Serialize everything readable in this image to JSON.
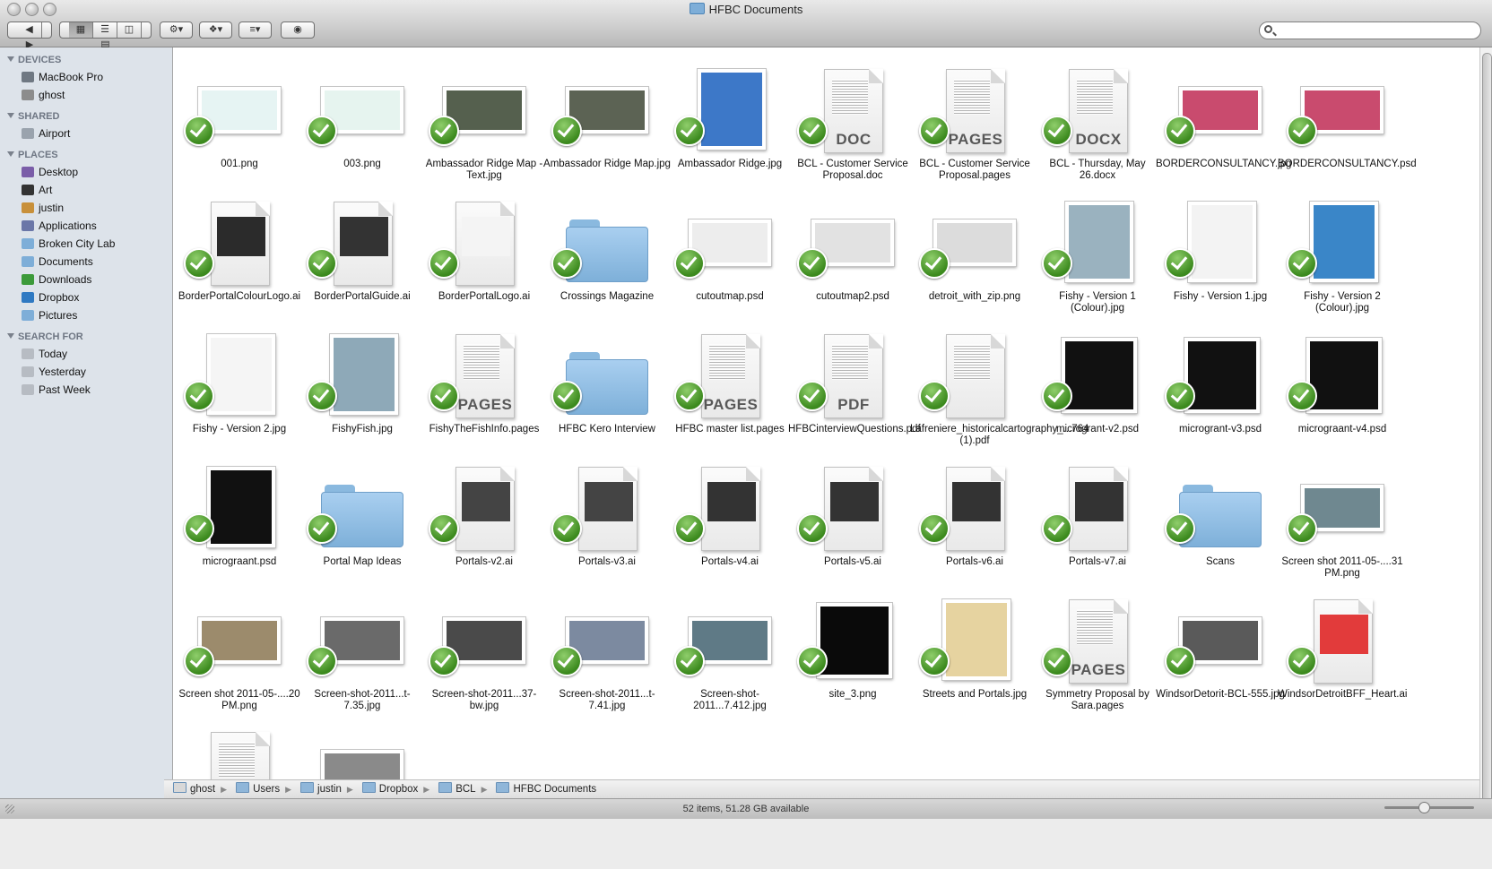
{
  "window": {
    "title": "HFBC Documents"
  },
  "sidebar": {
    "sections": [
      {
        "title": "DEVICES",
        "items": [
          "MacBook Pro",
          "ghost"
        ]
      },
      {
        "title": "SHARED",
        "items": [
          "Airport"
        ]
      },
      {
        "title": "PLACES",
        "items": [
          "Desktop",
          "Art",
          "justin",
          "Applications",
          "Broken City Lab",
          "Documents",
          "Downloads",
          "Dropbox",
          "Pictures"
        ]
      },
      {
        "title": "SEARCH FOR",
        "items": [
          "Today",
          "Yesterday",
          "Past Week"
        ]
      }
    ]
  },
  "files": [
    {
      "name": "001.png",
      "kind": "img",
      "c": "#e6f4f3"
    },
    {
      "name": "003.png",
      "kind": "img",
      "c": "#e6f4ef"
    },
    {
      "name": "Ambassador Ridge Map - Text.jpg",
      "kind": "img",
      "c": "#55604e"
    },
    {
      "name": "Ambassador Ridge Map.jpg",
      "kind": "img",
      "c": "#5c6354"
    },
    {
      "name": "Ambassador Ridge.jpg",
      "kind": "imgtall",
      "c": "#3d78c8"
    },
    {
      "name": "BCL - Customer Service Proposal.doc",
      "kind": "doc",
      "ext": "DOC"
    },
    {
      "name": "BCL - Customer Service Proposal.pages",
      "kind": "doc",
      "ext": "PAGES"
    },
    {
      "name": "BCL - Thursday, May 26.docx",
      "kind": "doc",
      "ext": "DOCX"
    },
    {
      "name": "BORDERCONSULTANCY.jpg",
      "kind": "img",
      "c": "#c94b6e"
    },
    {
      "name": "BORDERCONSULTANCY.psd",
      "kind": "img",
      "c": "#c94b6e"
    },
    {
      "name": "BorderPortalColourLogo.ai",
      "kind": "ai",
      "c": "#2b2b2b"
    },
    {
      "name": "BorderPortalGuide.ai",
      "kind": "ai",
      "c": "#333333"
    },
    {
      "name": "BorderPortalLogo.ai",
      "kind": "ai",
      "c": "#f4f4f4"
    },
    {
      "name": "Crossings Magazine",
      "kind": "folder"
    },
    {
      "name": "cutoutmap.psd",
      "kind": "img",
      "c": "#ededed"
    },
    {
      "name": "cutoutmap2.psd",
      "kind": "img",
      "c": "#e2e2e2"
    },
    {
      "name": "detroit_with_zip.png",
      "kind": "img",
      "c": "#dcdcdc"
    },
    {
      "name": "Fishy - Version 1 (Colour).jpg",
      "kind": "imgtall",
      "c": "#9ab2bf"
    },
    {
      "name": "Fishy - Version 1.jpg",
      "kind": "imgtall",
      "c": "#f3f3f3"
    },
    {
      "name": "Fishy - Version 2 (Colour).jpg",
      "kind": "imgtall",
      "c": "#3a86c8"
    },
    {
      "name": "Fishy - Version 2.jpg",
      "kind": "imgtall",
      "c": "#f5f5f5"
    },
    {
      "name": "FishyFish.jpg",
      "kind": "imgtall",
      "c": "#8ea9b8"
    },
    {
      "name": "FishyTheFishInfo.pages",
      "kind": "doc",
      "ext": "PAGES"
    },
    {
      "name": "HFBC Kero Interview",
      "kind": "folder"
    },
    {
      "name": "HFBC master list.pages",
      "kind": "doc",
      "ext": "PAGES"
    },
    {
      "name": "HFBCinterviewQuestions.pdf",
      "kind": "doc",
      "ext": "PDF"
    },
    {
      "name": "Lafreniere_historicalcartography_...764 (1).pdf",
      "kind": "doc",
      "ext": ""
    },
    {
      "name": "microgrant-v2.psd",
      "kind": "imgsq",
      "c": "#111111"
    },
    {
      "name": "microgrant-v3.psd",
      "kind": "imgsq",
      "c": "#111111"
    },
    {
      "name": "micrograant-v4.psd",
      "kind": "imgsq",
      "c": "#111111"
    },
    {
      "name": "micrograant.psd",
      "kind": "imgtall",
      "c": "#111111"
    },
    {
      "name": "Portal Map Ideas",
      "kind": "folder"
    },
    {
      "name": "Portals-v2.ai",
      "kind": "ai",
      "c": "#444444"
    },
    {
      "name": "Portals-v3.ai",
      "kind": "ai",
      "c": "#444444"
    },
    {
      "name": "Portals-v4.ai",
      "kind": "ai",
      "c": "#333333"
    },
    {
      "name": "Portals-v5.ai",
      "kind": "ai",
      "c": "#333333"
    },
    {
      "name": "Portals-v6.ai",
      "kind": "ai",
      "c": "#333333"
    },
    {
      "name": "Portals-v7.ai",
      "kind": "ai",
      "c": "#333333"
    },
    {
      "name": "Scans",
      "kind": "folder"
    },
    {
      "name": "Screen shot 2011-05-....31 PM.png",
      "kind": "img",
      "c": "#6f8890"
    },
    {
      "name": "Screen shot 2011-05-....20 PM.png",
      "kind": "img",
      "c": "#9c8b6c"
    },
    {
      "name": "Screen-shot-2011...t-7.35.jpg",
      "kind": "img",
      "c": "#6a6a6a"
    },
    {
      "name": "Screen-shot-2011...37-bw.jpg",
      "kind": "img",
      "c": "#4a4a4a"
    },
    {
      "name": "Screen-shot-2011...t-7.41.jpg",
      "kind": "img",
      "c": "#7c8aa0"
    },
    {
      "name": "Screen-shot-2011...7.412.jpg",
      "kind": "img",
      "c": "#5f7a86"
    },
    {
      "name": "site_3.png",
      "kind": "imgsq",
      "c": "#0a0a0a"
    },
    {
      "name": "Streets and Portals.jpg",
      "kind": "imgtall",
      "c": "#e6d3a0"
    },
    {
      "name": "Symmetry Proposal by Sara.pages",
      "kind": "doc",
      "ext": "PAGES"
    },
    {
      "name": "WindsorDetorit-BCL-555.jpg",
      "kind": "img",
      "c": "#5a5a5a"
    },
    {
      "name": "WindsorDetroitBFF_Heart.ai",
      "kind": "ai",
      "c": "#e23b3b"
    },
    {
      "name": "",
      "kind": "doc",
      "ext": ""
    },
    {
      "name": "",
      "kind": "img",
      "c": "#8a8a8a"
    }
  ],
  "pathbar": [
    "ghost",
    "Users",
    "justin",
    "Dropbox",
    "BCL",
    "HFBC Documents"
  ],
  "status": "52 items, 51.28 GB available"
}
